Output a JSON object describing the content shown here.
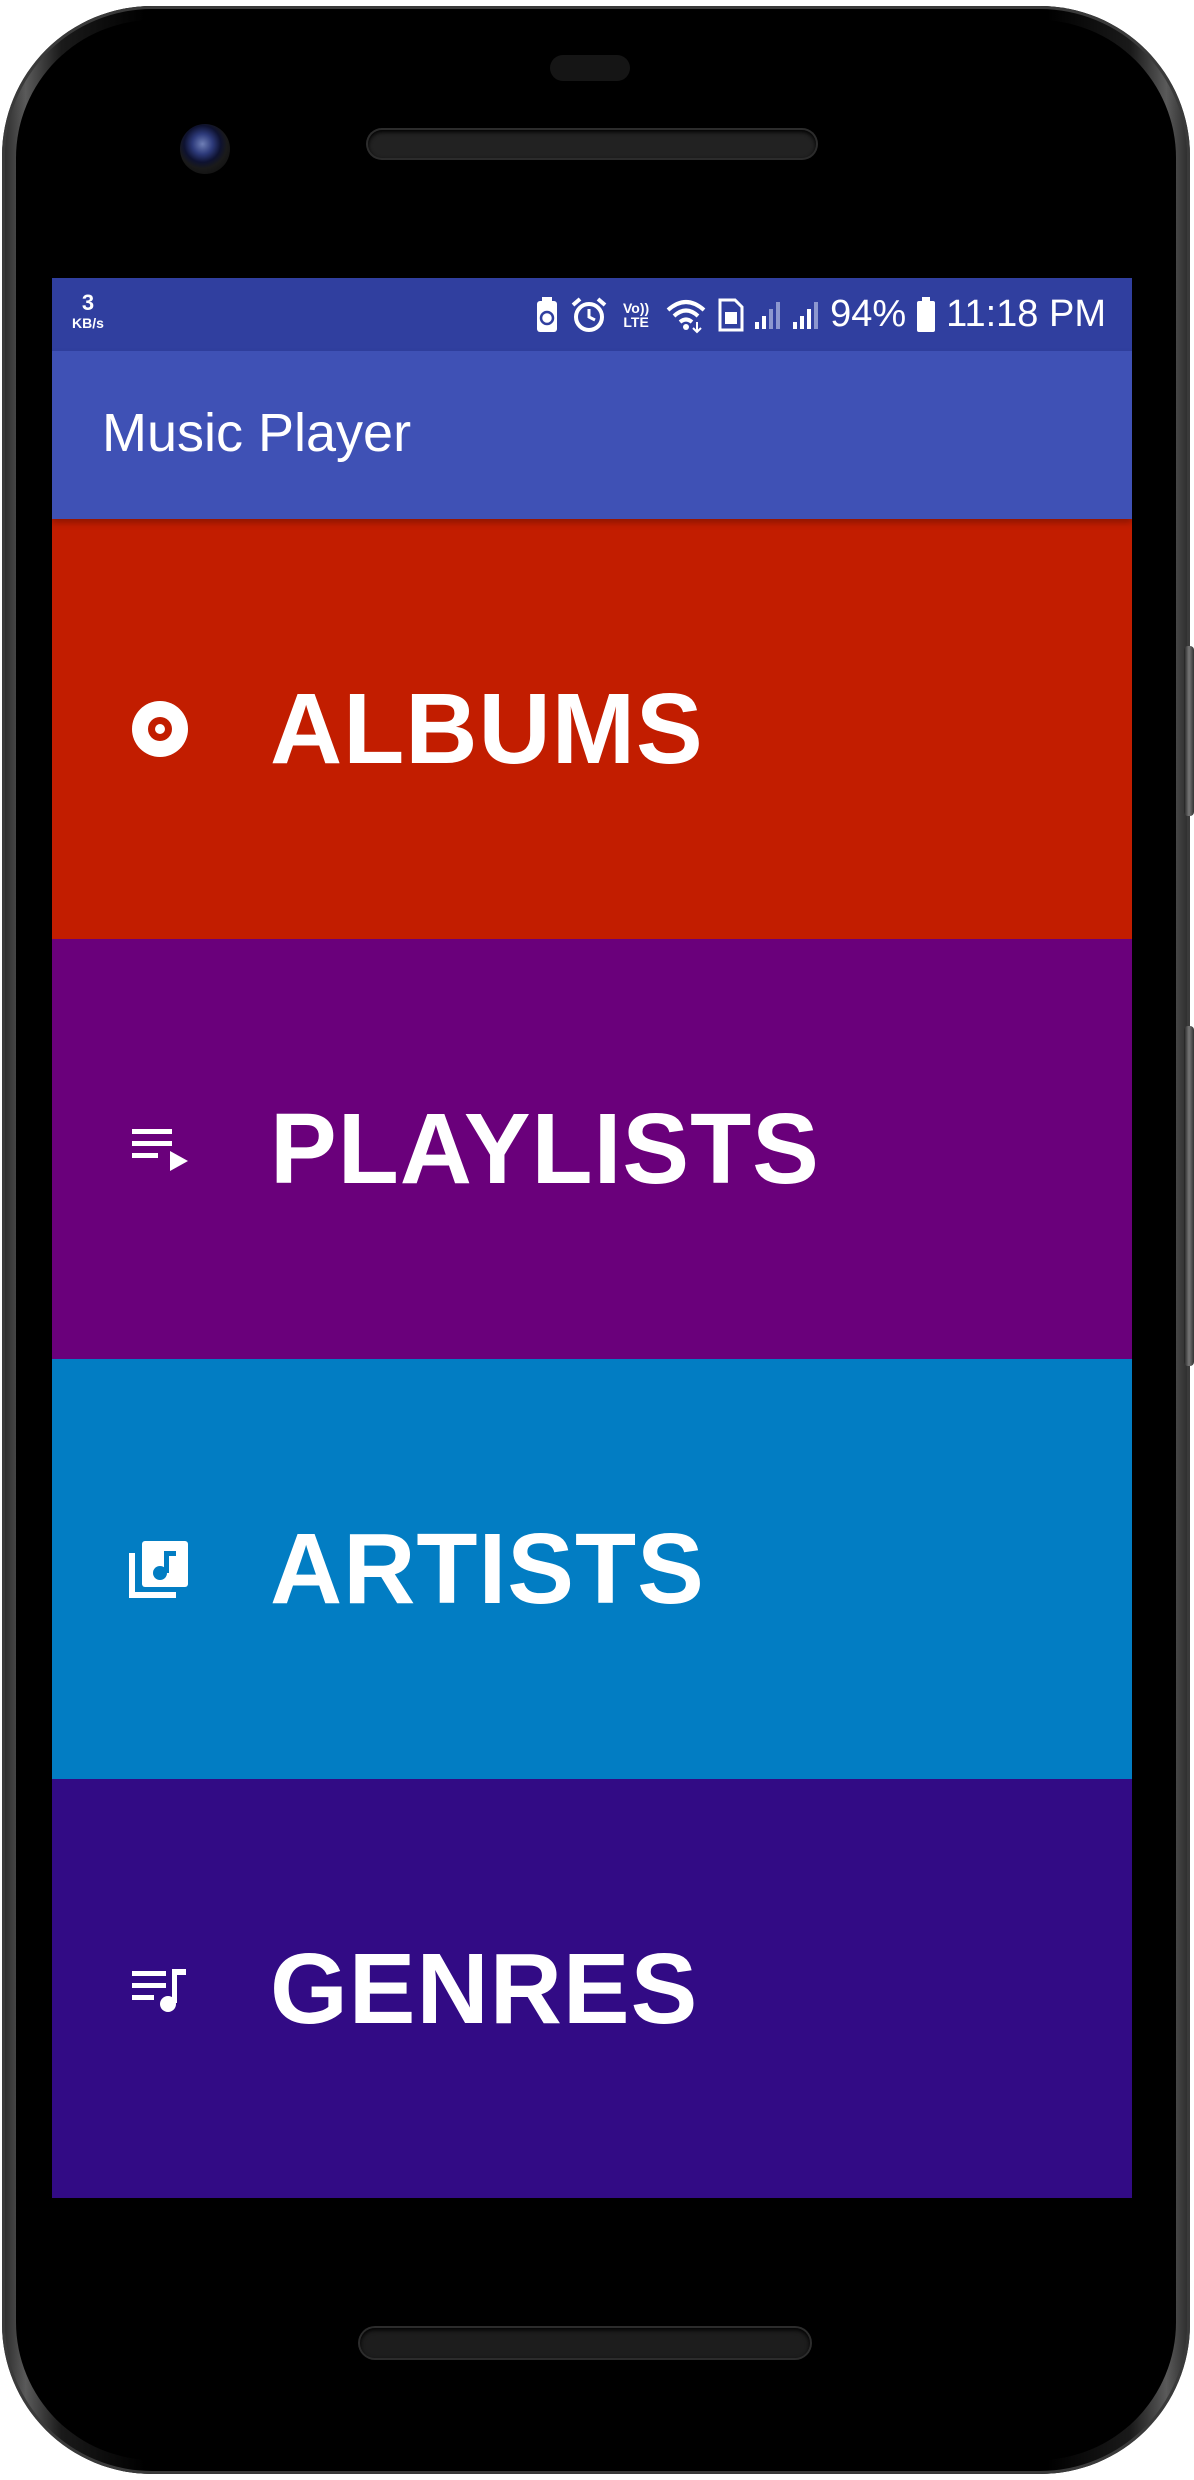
{
  "status_bar": {
    "net_speed_value": "3",
    "net_speed_unit": "KB/s",
    "volte_label": "Vo)) LTE",
    "battery_percent": "94%",
    "time": "11:18 PM",
    "background_color": "#303f9f"
  },
  "app_bar": {
    "title": "Music Player",
    "background_color": "#3f51b5"
  },
  "menu": {
    "items": [
      {
        "label": "ALBUMS",
        "icon": "album-disc-icon",
        "color": "#c21d00"
      },
      {
        "label": "PLAYLISTS",
        "icon": "playlist-play-icon",
        "color": "#6a007b"
      },
      {
        "label": "ARTISTS",
        "icon": "library-music-icon",
        "color": "#027dc3"
      },
      {
        "label": "GENRES",
        "icon": "queue-music-icon",
        "color": "#320b85"
      }
    ]
  }
}
